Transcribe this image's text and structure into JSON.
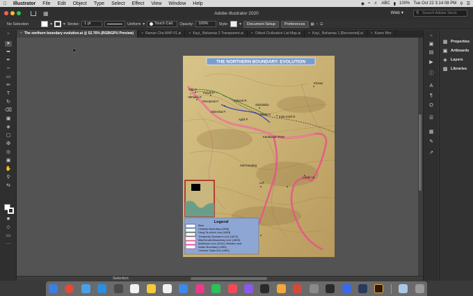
{
  "menubar": {
    "app": "Illustrator",
    "items": [
      "File",
      "Edit",
      "Object",
      "Type",
      "Select",
      "Effect",
      "View",
      "Window",
      "Help"
    ],
    "status_icons": [
      "creative-cloud-icon",
      "wifi-icon",
      "bluetooth-icon",
      "volume-icon",
      "battery-icon",
      "search-icon",
      "siri-icon"
    ],
    "keyboard": "ABC",
    "battery": "100%",
    "clock": "Tue Oct 22  3:14 08 PM"
  },
  "appbar": {
    "title": "Adobe Illustrator 2020",
    "workspace": "Web",
    "search_placeholder": "Search Adobe Stock"
  },
  "controlbar": {
    "selection": "No Selection",
    "stroke_label": "Stroke:",
    "stroke_weight": "1 pt",
    "profile": "Uniform",
    "brush": "Touch Call.",
    "opacity_label": "Opacity:",
    "opacity": "100%",
    "style_label": "Style:",
    "doc_setup": "Document Setup",
    "preferences": "Preferences"
  },
  "tabs": [
    {
      "label": "The northern boundary evolution.ai @ 52.76% (RGB/GPU Preview)",
      "active": true
    },
    {
      "label": "Raman Cha MAP-01.ai",
      "active": false
    },
    {
      "label": "Kayi_ Bahamas 2 Transparent.ai",
      "active": false
    },
    {
      "label": "Oldest Civilization List Map.ai",
      "active": false
    },
    {
      "label": "Kayi_ Bahamas 1 [Recovered].ai",
      "active": false
    },
    {
      "label": "Karen Wor",
      "active": false
    }
  ],
  "statusbar": {
    "zoom_label": "Selection"
  },
  "rpanel": {
    "items": [
      {
        "label": "Properties",
        "icon": "properties-icon"
      },
      {
        "label": "Artboards",
        "icon": "artboards-icon"
      },
      {
        "label": "Layers",
        "icon": "layers-icon"
      },
      {
        "label": "Libraries",
        "icon": "libraries-icon"
      }
    ]
  },
  "map": {
    "title": "THE NORTHERN BOUNDARY: EVOLUTION",
    "places": [
      "Kilik P.",
      "Parpik P.",
      "Mintaka P.",
      "Khunjerab P.",
      "Yarkand R.",
      "Shahidulla",
      "Sonde P.",
      "Kala Kash R.",
      "Shimshal P.",
      "Aghil P.",
      "Khotan",
      "Karakoram Pass",
      "Samzungling",
      "Leh",
      "Lanak La"
    ],
    "legend_title": "Legend",
    "legend_items": [
      "Blue:",
      "Chinese Boundary (1890)",
      "Hung Ta-chin's Line (1893)",
      "Trelawney Saunder's Line (1873)",
      "MacDonald-Macartney Line (1899)",
      "McMahon Line (1914): Western and",
      "Indian Boundary (1954)",
      "Chinese Claim line (1960)"
    ]
  },
  "colors": {
    "accent_pink": "#e9528a",
    "line_blue": "#2233cc",
    "title_bg": "#7b9ccc",
    "legend_bg": "#8ea6d4"
  }
}
